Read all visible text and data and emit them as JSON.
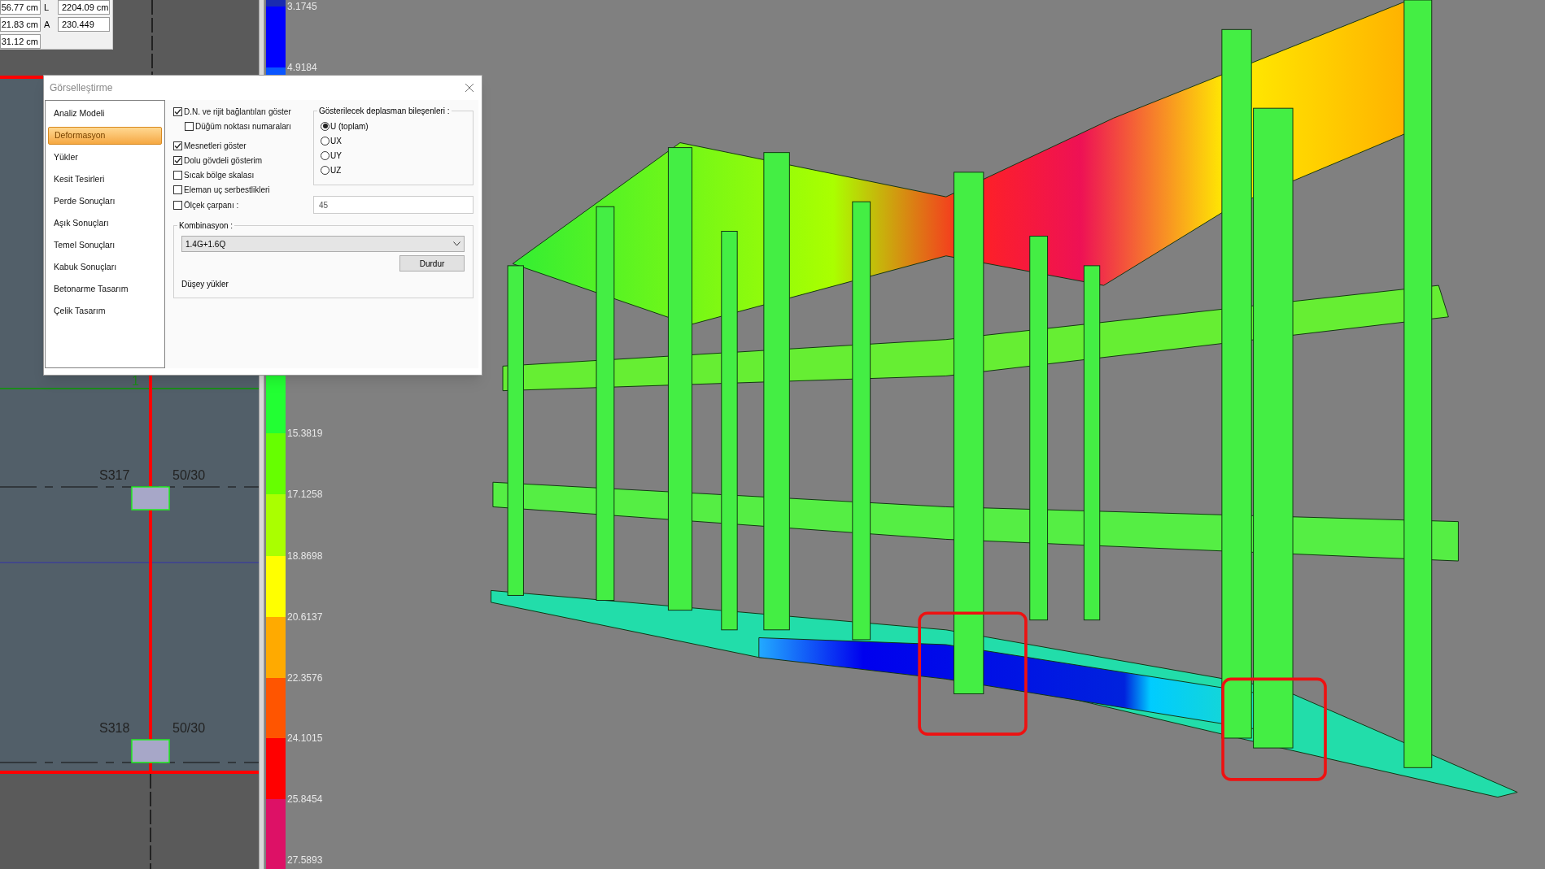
{
  "measure_panel": {
    "rows": [
      {
        "value": "56.77 cm",
        "label": "L",
        "value_2": "2204.09 cm"
      },
      {
        "value": "21.83 cm",
        "label": "A",
        "value_2": "230.449"
      },
      {
        "value": "31.12 cm"
      }
    ]
  },
  "plan": {
    "axis_label": "1",
    "columns": [
      {
        "name": "S317",
        "size": "50/30"
      },
      {
        "name": "S318",
        "size": "50/30"
      }
    ]
  },
  "legend": {
    "bands": [
      {
        "color": "#1a2bb0"
      },
      {
        "color": "#0000ff"
      },
      {
        "color": "#0a55ff"
      },
      {
        "color": "#22ff33"
      },
      {
        "color": "#66ff00"
      },
      {
        "color": "#aaff00"
      },
      {
        "color": "#ffff00"
      },
      {
        "color": "#ffaa00"
      },
      {
        "color": "#ff5500"
      },
      {
        "color": "#ff0000"
      },
      {
        "color": "#dd1166"
      }
    ],
    "ticks": [
      "3.1745",
      "4.9184",
      "15.3819",
      "17.1258",
      "18.8698",
      "20.6137",
      "22.3576",
      "24.1015",
      "25.8454",
      "27.5893"
    ]
  },
  "dialog": {
    "title": "Görselleştirme",
    "nav": [
      {
        "label": "Analiz Modeli",
        "selected": false
      },
      {
        "label": "Deformasyon",
        "selected": true
      },
      {
        "label": "Yükler",
        "selected": false
      },
      {
        "label": "Kesit Tesirleri",
        "selected": false
      },
      {
        "label": "Perde Sonuçları",
        "selected": false
      },
      {
        "label": "Aşık Sonuçları",
        "selected": false
      },
      {
        "label": "Temel Sonuçları",
        "selected": false
      },
      {
        "label": "Kabuk Sonuçları",
        "selected": false
      },
      {
        "label": "Betonarme Tasarım",
        "selected": false
      },
      {
        "label": "Çelik Tasarım",
        "selected": false
      }
    ],
    "options": [
      {
        "label": "D.N. ve rijit bağlantıları göster",
        "checked": true,
        "children": [
          {
            "label": "Düğüm noktası numaraları",
            "checked": false
          }
        ]
      },
      {
        "label": "Mesnetleri göster",
        "checked": true
      },
      {
        "label": "Dolu gövdeli gösterim",
        "checked": true
      },
      {
        "label": "Sıcak bölge skalası",
        "checked": false
      },
      {
        "label": "Eleman uç serbestlikleri",
        "checked": false
      },
      {
        "label": "Ölçek çarpanı :",
        "checked": false
      }
    ],
    "components": {
      "title": "Gösterilecek deplasman bileşenleri :",
      "options": [
        {
          "label": "U (toplam)",
          "selected": true
        },
        {
          "label": "UX",
          "selected": false
        },
        {
          "label": "UY",
          "selected": false
        },
        {
          "label": "UZ",
          "selected": false
        }
      ]
    },
    "scale_field": {
      "value": "45"
    },
    "combination": {
      "title": "Kombinasyon :",
      "value": "1.4G+1.6Q",
      "button": "Durdur",
      "note": "Düşey yükler"
    }
  }
}
